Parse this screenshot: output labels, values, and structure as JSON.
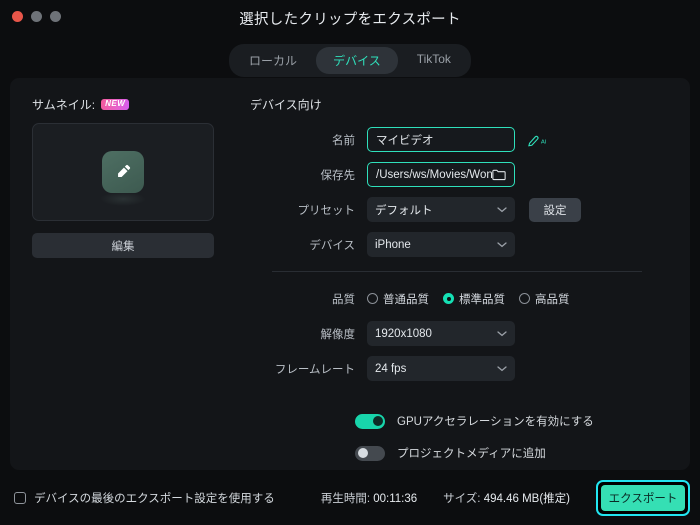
{
  "window": {
    "title": "選択したクリップをエクスポート",
    "traffic_lights": [
      "close",
      "minimize",
      "maximize"
    ]
  },
  "tabs": [
    {
      "label": "ローカル",
      "active": false
    },
    {
      "label": "デバイス",
      "active": true
    },
    {
      "label": "TikTok",
      "active": false
    }
  ],
  "thumbnail": {
    "label": "サムネイル:",
    "badge": "NEW",
    "edit_button": "編集",
    "icon": "pencil-edit-icon"
  },
  "form": {
    "section_title": "デバイス向け",
    "name": {
      "label": "名前",
      "value": "マイビデオ",
      "placeholder": "マイビデオ",
      "ai_icon": "ai-pen-icon"
    },
    "destination": {
      "label": "保存先",
      "value": "/Users/ws/Movies/Wonc",
      "folder_icon": "folder-icon"
    },
    "preset": {
      "label": "プリセット",
      "value": "デフォルト",
      "settings_button": "設定"
    },
    "device": {
      "label": "デバイス",
      "value": "iPhone"
    },
    "quality": {
      "label": "品質",
      "options": [
        {
          "label": "普通品質",
          "selected": false
        },
        {
          "label": "標準品質",
          "selected": true
        },
        {
          "label": "高品質",
          "selected": false
        }
      ]
    },
    "resolution": {
      "label": "解像度",
      "value": "1920x1080"
    },
    "framerate": {
      "label": "フレームレート",
      "value": "24 fps"
    },
    "toggles": [
      {
        "label": "GPUアクセラレーションを有効にする",
        "on": true
      },
      {
        "label": "プロジェクトメディアに追加",
        "on": false
      }
    ]
  },
  "bottom": {
    "remember_checkbox": {
      "label": "デバイスの最後のエクスポート設定を使用する",
      "checked": false
    },
    "duration": {
      "label": "再生時間:",
      "value": "00:11:36"
    },
    "size": {
      "label": "サイズ:",
      "value": "494.46 MB(推定)"
    },
    "export_button": "エクスポート"
  },
  "colors": {
    "accent": "#2fe0bb",
    "accent_button": "#35dfb4",
    "focus_ring": "#22e5f0",
    "badge_pink": "#f45a9b",
    "window_bg": "#0c0d0f",
    "card_bg": "#131518"
  }
}
